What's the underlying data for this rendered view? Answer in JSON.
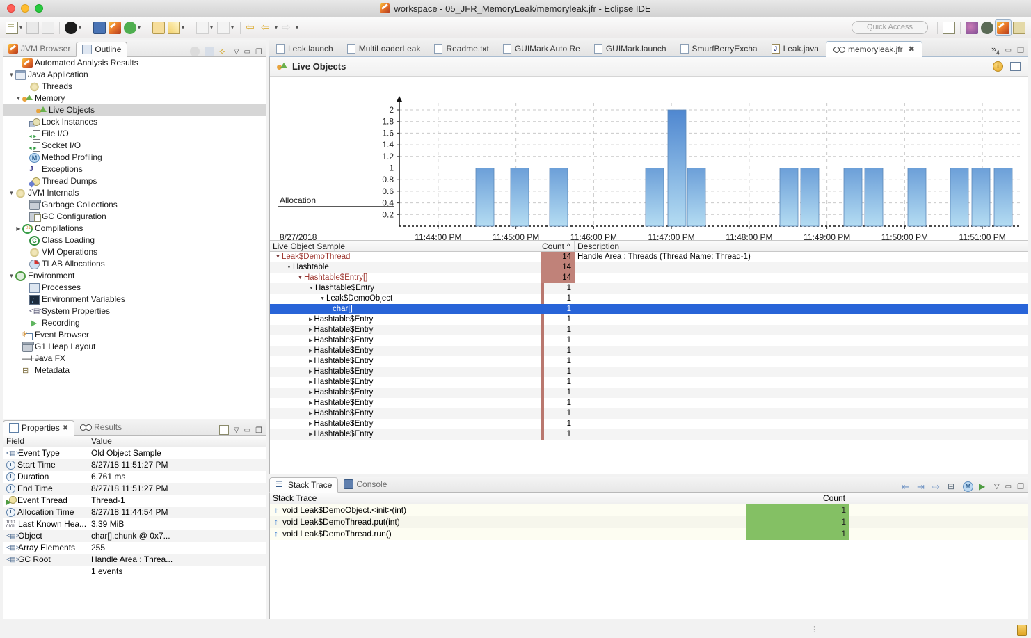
{
  "window": {
    "title": "workspace - 05_JFR_MemoryLeak/memoryleak.jfr - Eclipse IDE"
  },
  "toolbar": {
    "quick_access_placeholder": "Quick Access",
    "items": [
      {
        "name": "new-wizard",
        "glyph": "new"
      },
      {
        "name": "save",
        "glyph": "save"
      },
      {
        "name": "save-all",
        "glyph": "save-all"
      },
      {
        "name": "user-profile",
        "glyph": "user"
      },
      {
        "name": "open-console",
        "glyph": "console"
      },
      {
        "name": "mission-control",
        "glyph": "eclipse"
      },
      {
        "name": "run",
        "glyph": "run"
      },
      {
        "name": "open-folder",
        "glyph": "folder"
      },
      {
        "name": "pencil",
        "glyph": "pencil"
      },
      {
        "name": "download",
        "glyph": "download"
      },
      {
        "name": "upload",
        "glyph": "upload"
      },
      {
        "name": "back-star",
        "glyph": "back-star"
      },
      {
        "name": "back",
        "glyph": "back"
      },
      {
        "name": "forward",
        "glyph": "forward"
      }
    ],
    "perspective_items": [
      "new-perspective",
      "java-perspective",
      "debug-perspective",
      "mission-control-perspective",
      "hierarchy-perspective"
    ]
  },
  "left_panel": {
    "tabs": [
      {
        "label": "JVM Browser",
        "icon": "eclipse-icon",
        "active": false
      },
      {
        "label": "Outline",
        "icon": "outline-icon",
        "active": true
      }
    ],
    "tools": [
      "collapse-all-icon",
      "link-with-editor-icon",
      "flashlight-icon",
      "view-menu-icon",
      "minimize-icon",
      "maximize-icon"
    ],
    "tree": [
      {
        "label": "Automated Analysis Results",
        "indent": 1,
        "twisty": "",
        "icon": "eclipse-icon",
        "selected": false
      },
      {
        "label": "Java Application",
        "indent": 0,
        "twisty": "▼",
        "icon": "java-app-icon",
        "selected": false
      },
      {
        "label": "Threads",
        "indent": 2,
        "twisty": "",
        "icon": "threads-icon",
        "selected": false
      },
      {
        "label": "Memory",
        "indent": 1,
        "twisty": "▼",
        "icon": "memory-icon",
        "selected": false
      },
      {
        "label": "Live Objects",
        "indent": 3,
        "twisty": "",
        "icon": "live-objects-icon",
        "selected": true
      },
      {
        "label": "Lock Instances",
        "indent": 2,
        "twisty": "",
        "icon": "lock-icon",
        "selected": false
      },
      {
        "label": "File I/O",
        "indent": 2,
        "twisty": "",
        "icon": "file-io-icon",
        "selected": false
      },
      {
        "label": "Socket I/O",
        "indent": 2,
        "twisty": "",
        "icon": "socket-io-icon",
        "selected": false
      },
      {
        "label": "Method Profiling",
        "indent": 2,
        "twisty": "",
        "icon": "method-profiling-icon",
        "selected": false
      },
      {
        "label": "Exceptions",
        "indent": 2,
        "twisty": "",
        "icon": "exceptions-icon",
        "selected": false
      },
      {
        "label": "Thread Dumps",
        "indent": 2,
        "twisty": "",
        "icon": "thread-dumps-icon",
        "selected": false
      },
      {
        "label": "JVM Internals",
        "indent": 0,
        "twisty": "▼",
        "icon": "jvm-internals-icon",
        "selected": false
      },
      {
        "label": "Garbage Collections",
        "indent": 2,
        "twisty": "",
        "icon": "garbage-collections-icon",
        "selected": false
      },
      {
        "label": "GC Configuration",
        "indent": 2,
        "twisty": "",
        "icon": "gc-configuration-icon",
        "selected": false
      },
      {
        "label": "Compilations",
        "indent": 1,
        "twisty": "▶",
        "icon": "compilations-icon",
        "selected": false
      },
      {
        "label": "Class Loading",
        "indent": 2,
        "twisty": "",
        "icon": "class-loading-icon",
        "selected": false
      },
      {
        "label": "VM Operations",
        "indent": 2,
        "twisty": "",
        "icon": "vm-operations-icon",
        "selected": false
      },
      {
        "label": "TLAB Allocations",
        "indent": 2,
        "twisty": "",
        "icon": "tlab-allocations-icon",
        "selected": false
      },
      {
        "label": "Environment",
        "indent": 0,
        "twisty": "▼",
        "icon": "environment-icon",
        "selected": false
      },
      {
        "label": "Processes",
        "indent": 2,
        "twisty": "",
        "icon": "processes-icon",
        "selected": false
      },
      {
        "label": "Environment Variables",
        "indent": 2,
        "twisty": "",
        "icon": "environment-variables-icon",
        "selected": false
      },
      {
        "label": "System Properties",
        "indent": 2,
        "twisty": "",
        "icon": "system-properties-icon",
        "selected": false
      },
      {
        "label": "Recording",
        "indent": 2,
        "twisty": "",
        "icon": "recording-icon",
        "selected": false
      },
      {
        "label": "Event Browser",
        "indent": 1,
        "twisty": "",
        "icon": "event-browser-icon",
        "selected": false
      },
      {
        "label": "G1 Heap Layout",
        "indent": 1,
        "twisty": "",
        "icon": "g1-heap-layout-icon",
        "selected": false
      },
      {
        "label": "Java FX",
        "indent": 1,
        "twisty": "",
        "icon": "java-fx-icon",
        "selected": false
      },
      {
        "label": "Metadata",
        "indent": 1,
        "twisty": "",
        "icon": "metadata-icon",
        "selected": false
      }
    ]
  },
  "properties": {
    "tabs": [
      {
        "label": "Properties",
        "active": true,
        "closable": true
      },
      {
        "label": "Results",
        "active": false,
        "closable": false
      }
    ],
    "tools": [
      "new-properties-view-icon",
      "view-menu-icon",
      "minimize-icon",
      "maximize-icon"
    ],
    "columns": [
      "Field",
      "Value"
    ],
    "rows": [
      {
        "field": "Event Type",
        "value": "Old Object Sample",
        "icon": "tag-icon"
      },
      {
        "field": "Start Time",
        "value": "8/27/18 11:51:27 PM",
        "icon": "clock-icon"
      },
      {
        "field": "Duration",
        "value": "6.761 ms",
        "icon": "duration-icon"
      },
      {
        "field": "End Time",
        "value": "8/27/18 11:51:27 PM",
        "icon": "clock-icon"
      },
      {
        "field": "Event Thread",
        "value": "Thread-1",
        "icon": "thread-icon"
      },
      {
        "field": "Allocation Time",
        "value": "8/27/18 11:44:54 PM",
        "icon": "clock-icon"
      },
      {
        "field": "Last Known Hea...",
        "value": "3.39 MiB",
        "icon": "bits-icon"
      },
      {
        "field": "Object",
        "value": "char[].chunk @ 0x7...",
        "icon": "tag-icon"
      },
      {
        "field": "Array Elements",
        "value": "255",
        "icon": "tag-icon"
      },
      {
        "field": "GC Root",
        "value": "Handle Area : Threa...",
        "icon": "tag-icon"
      },
      {
        "field": "",
        "value": "1 events",
        "icon": ""
      }
    ]
  },
  "editor": {
    "tabs": [
      {
        "label": "Leak.launch",
        "icon": "file-icon",
        "active": false
      },
      {
        "label": "MultiLoaderLeak",
        "icon": "file-icon",
        "active": false
      },
      {
        "label": "Readme.txt",
        "icon": "file-icon",
        "active": false
      },
      {
        "label": "GUIMark Auto Re",
        "icon": "file-icon",
        "active": false
      },
      {
        "label": "GUIMark.launch",
        "icon": "file-icon",
        "active": false
      },
      {
        "label": "SmurfBerryExcha",
        "icon": "file-icon",
        "active": false
      },
      {
        "label": "Leak.java",
        "icon": "java-icon",
        "active": false
      },
      {
        "label": "memoryleak.jfr",
        "icon": "jfr-icon",
        "active": true,
        "close": "✖"
      }
    ],
    "overflow_label": "»",
    "overflow_count": "4",
    "page_title": "Live Objects",
    "header_tools": [
      "info-icon",
      "table-view-icon"
    ]
  },
  "chart_data": {
    "type": "bar",
    "title": "Live Objects",
    "xlabel": "",
    "ylabel": "",
    "ylim": [
      0,
      2
    ],
    "yticks": [
      0.2,
      0.4,
      0.6,
      0.8,
      1,
      1.2,
      1.4,
      1.6,
      1.8,
      2
    ],
    "ytick_labels": [
      "0.2",
      "0.4",
      "0.6",
      "0.8",
      "1",
      "1.2",
      "1.4",
      "1.6",
      "1.8",
      "2"
    ],
    "xticks": [
      "11:44:00 PM",
      "11:45:00 PM",
      "11:46:00 PM",
      "11:47:00 PM",
      "11:48:00 PM",
      "11:49:00 PM",
      "11:50:00 PM",
      "11:51:00 PM"
    ],
    "lane_label": "Allocation",
    "date_label": "8/27/2018",
    "grid": true,
    "legend": null,
    "bar_color": "#7fb4e0",
    "x": [
      "11:44:05 PM",
      "11:44:30 PM",
      "11:45:00 PM",
      "11:46:15 PM",
      "11:46:35 PM",
      "11:46:50 PM",
      "11:47:55 PM",
      "11:48:10 PM",
      "11:48:40 PM",
      "11:48:55 PM",
      "11:49:25 PM",
      "11:50:00 PM",
      "11:50:30 PM",
      "11:50:45 PM"
    ],
    "values": [
      1,
      1,
      1,
      1,
      2,
      1,
      1,
      1,
      1,
      1,
      1,
      1,
      1,
      1
    ]
  },
  "live_object_sample": {
    "columns": [
      "Live Object Sample",
      "Count",
      "Description"
    ],
    "sort_column": "Count",
    "sort_indicator": "^",
    "rows": [
      {
        "label": "Leak$DemoThread",
        "indent": 0,
        "twisty": "▼",
        "count": "14",
        "desc": "Handle Area : Threads (Thread Name: Thread-1)",
        "style": "red",
        "heat": "wide",
        "selected": false
      },
      {
        "label": "Hashtable",
        "indent": 1,
        "twisty": "▼",
        "count": "14",
        "desc": "",
        "style": "dark",
        "heat": "wide",
        "selected": false
      },
      {
        "label": "Hashtable$Entry[]",
        "indent": 2,
        "twisty": "▼",
        "count": "14",
        "desc": "",
        "style": "red",
        "heat": "wide",
        "selected": false
      },
      {
        "label": "Hashtable$Entry",
        "indent": 3,
        "twisty": "▼",
        "count": "1",
        "desc": "",
        "style": "dark",
        "heat": "thin",
        "selected": false
      },
      {
        "label": "Leak$DemoObject",
        "indent": 4,
        "twisty": "▼",
        "count": "1",
        "desc": "",
        "style": "dark",
        "heat": "thin",
        "selected": false
      },
      {
        "label": "char[]",
        "indent": 5,
        "twisty": "",
        "count": "1",
        "desc": "",
        "style": "dark",
        "heat": "thin",
        "selected": true
      },
      {
        "label": "Hashtable$Entry",
        "indent": 3,
        "twisty": "▶",
        "count": "1",
        "desc": "",
        "style": "dark",
        "heat": "thin",
        "selected": false
      },
      {
        "label": "Hashtable$Entry",
        "indent": 3,
        "twisty": "▶",
        "count": "1",
        "desc": "",
        "style": "dark",
        "heat": "thin",
        "selected": false
      },
      {
        "label": "Hashtable$Entry",
        "indent": 3,
        "twisty": "▶",
        "count": "1",
        "desc": "",
        "style": "dark",
        "heat": "thin",
        "selected": false
      },
      {
        "label": "Hashtable$Entry",
        "indent": 3,
        "twisty": "▶",
        "count": "1",
        "desc": "",
        "style": "dark",
        "heat": "thin",
        "selected": false
      },
      {
        "label": "Hashtable$Entry",
        "indent": 3,
        "twisty": "▶",
        "count": "1",
        "desc": "",
        "style": "dark",
        "heat": "thin",
        "selected": false
      },
      {
        "label": "Hashtable$Entry",
        "indent": 3,
        "twisty": "▶",
        "count": "1",
        "desc": "",
        "style": "dark",
        "heat": "thin",
        "selected": false
      },
      {
        "label": "Hashtable$Entry",
        "indent": 3,
        "twisty": "▶",
        "count": "1",
        "desc": "",
        "style": "dark",
        "heat": "thin",
        "selected": false
      },
      {
        "label": "Hashtable$Entry",
        "indent": 3,
        "twisty": "▶",
        "count": "1",
        "desc": "",
        "style": "dark",
        "heat": "thin",
        "selected": false
      },
      {
        "label": "Hashtable$Entry",
        "indent": 3,
        "twisty": "▶",
        "count": "1",
        "desc": "",
        "style": "dark",
        "heat": "thin",
        "selected": false
      },
      {
        "label": "Hashtable$Entry",
        "indent": 3,
        "twisty": "▶",
        "count": "1",
        "desc": "",
        "style": "dark",
        "heat": "thin",
        "selected": false
      },
      {
        "label": "Hashtable$Entry",
        "indent": 3,
        "twisty": "▶",
        "count": "1",
        "desc": "",
        "style": "dark",
        "heat": "thin",
        "selected": false
      },
      {
        "label": "Hashtable$Entry",
        "indent": 3,
        "twisty": "▶",
        "count": "1",
        "desc": "",
        "style": "dark",
        "heat": "thin",
        "selected": false
      }
    ]
  },
  "stack_trace": {
    "tabs": [
      {
        "label": "Stack Trace",
        "active": true,
        "icon": "stack-icon"
      },
      {
        "label": "Console",
        "active": false,
        "icon": "console-icon"
      }
    ],
    "tools": [
      "prev-frame-icon",
      "distinguish-frames-icon",
      "next-frame-icon",
      "tree-layout-icon",
      "method-icon",
      "thread-root-icon",
      "view-menu-icon",
      "minimize-icon",
      "maximize-icon"
    ],
    "columns": [
      "Stack Trace",
      "Count"
    ],
    "rows": [
      {
        "frame": "void Leak$DemoObject.<init>(int)",
        "count": "1"
      },
      {
        "frame": "void Leak$DemoThread.put(int)",
        "count": "1"
      },
      {
        "frame": "void Leak$DemoThread.run()",
        "count": "1"
      }
    ]
  },
  "colors": {
    "selection_blue": "#2864d8",
    "heat_red": "#c08279",
    "count_green": "#84c064",
    "bar_blue": "#7fb4e0",
    "accent_orange": "#e8a33d"
  }
}
